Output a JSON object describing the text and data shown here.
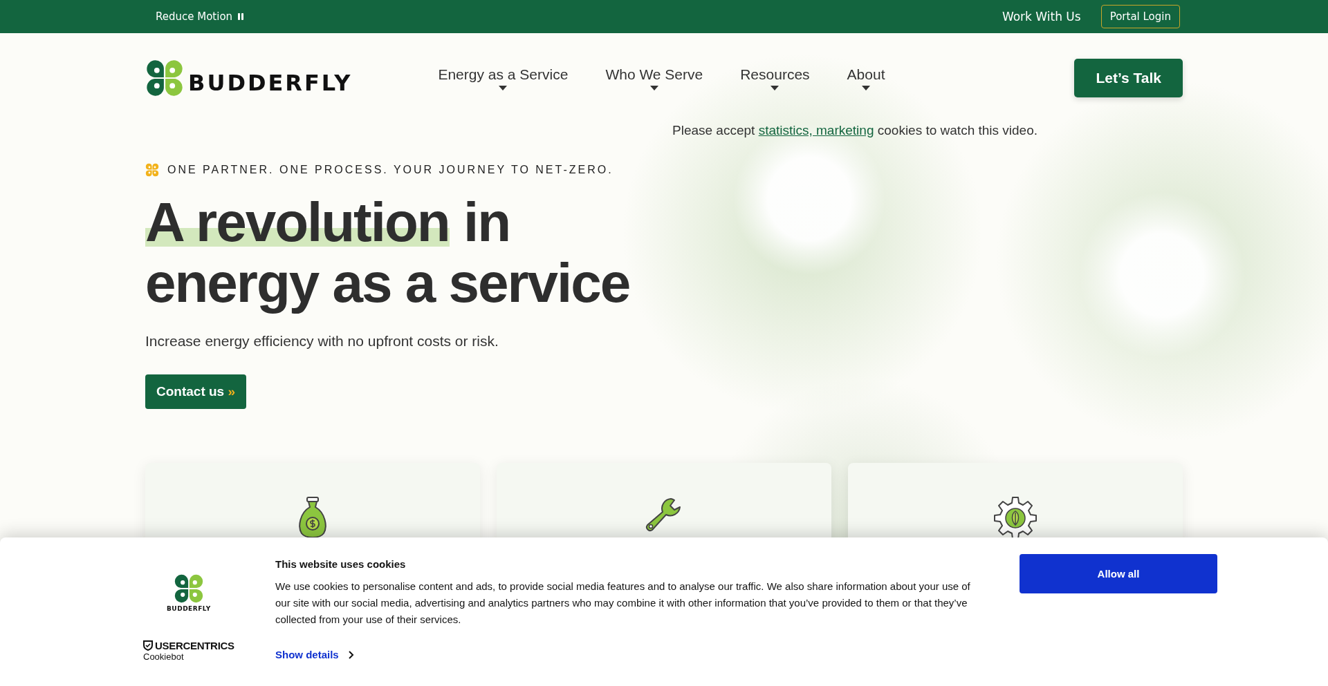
{
  "top_bar": {
    "reduce_motion": "Reduce Motion",
    "work_with_us": "Work With Us",
    "portal_login": "Portal Login"
  },
  "header": {
    "logo": "BUDDERFLY",
    "nav": [
      {
        "label": "Energy as a Service"
      },
      {
        "label": "Who We Serve"
      },
      {
        "label": "Resources"
      },
      {
        "label": "About"
      }
    ],
    "cta": "Let’s Talk"
  },
  "video_notice": {
    "before": "Please accept",
    "link": "statistics, marketing",
    "after": "cookies to watch this video."
  },
  "hero": {
    "tagline": "ONE PARTNER. ONE PROCESS. YOUR JOURNEY TO NET-ZERO.",
    "headline_highlight": "A revolution",
    "headline_rest": "in energy as a service",
    "subtitle": "Increase energy efficiency with no upfront costs or risk.",
    "button": "Contact us",
    "button_suffix": "»"
  },
  "cards": [
    {
      "kind": "money-bag"
    },
    {
      "kind": "wrench"
    },
    {
      "kind": "gear-leaf"
    }
  ],
  "cookie_banner": {
    "logo_text": "BUDDERFLY",
    "brand": "USERCENTRICS",
    "brand_sub": "Cookiebot",
    "title": "This website uses cookies",
    "body": "We use cookies to personalise content and ads, to provide social media features and to analyse our traffic. We also share information about your use of our site with our social media, advertising and analytics partners who may combine it with other information that you’ve provided to them or that they’ve collected from your use of their services.",
    "show_details": "Show details",
    "allow_all": "Allow all"
  }
}
